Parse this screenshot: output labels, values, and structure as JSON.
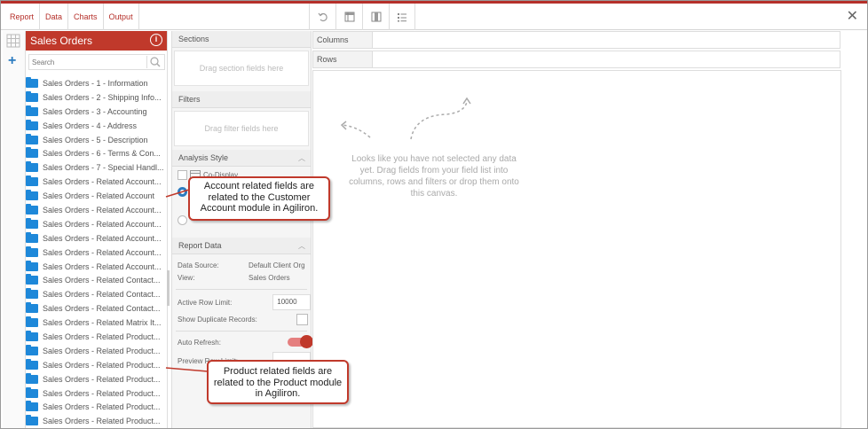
{
  "menu": {
    "tabs": [
      "Report",
      "Data",
      "Charts",
      "Output"
    ],
    "close_icon": "close-icon",
    "accent": "#b5302a"
  },
  "toolbar": {
    "icons": [
      "undo-icon",
      "pivot-table-icon",
      "column-layout-icon",
      "list-icon"
    ]
  },
  "rail": {
    "grid_icon": "grid-icon",
    "add_icon": "plus-icon"
  },
  "fieldlist": {
    "title": "Sales Orders",
    "info_icon": "info-icon",
    "search_placeholder": "Search",
    "header_color": "#c0392b",
    "folder_color": "#1e88d9",
    "items": [
      "Sales Orders - 1 - Information",
      "Sales Orders - 2 - Shipping Info...",
      "Sales Orders - 3 - Accounting",
      "Sales Orders - 4 - Address",
      "Sales Orders - 5 - Description",
      "Sales Orders - 6 - Terms & Con...",
      "Sales Orders - 7 - Special Handl...",
      "Sales Orders - Related Account...",
      "Sales Orders - Related Account",
      "Sales Orders - Related Account...",
      "Sales Orders - Related Account...",
      "Sales Orders - Related Account...",
      "Sales Orders - Related Account...",
      "Sales Orders - Related Account...",
      "Sales Orders - Related Contact...",
      "Sales Orders - Related Contact...",
      "Sales Orders - Related Contact...",
      "Sales Orders - Related Matrix It...",
      "Sales Orders - Related Product...",
      "Sales Orders - Related Product...",
      "Sales Orders - Related Product...",
      "Sales Orders - Related Product...",
      "Sales Orders - Related Product...",
      "Sales Orders - Related Product...",
      "Sales Orders - Related Product..."
    ]
  },
  "sections": {
    "title": "Sections",
    "drop_hint": "Drag section fields here"
  },
  "filters": {
    "title": "Filters",
    "drop_hint": "Drag filter fields here"
  },
  "analysis": {
    "title": "Analysis Style",
    "co_display": "Co-Display"
  },
  "report_data": {
    "title": "Report Data",
    "data_source_label": "Data Source:",
    "data_source_value": "Default Client Org",
    "view_label": "View:",
    "view_value": "Sales Orders",
    "row_limit_label": "Active Row Limit:",
    "row_limit_value": "10000",
    "dup_label": "Show Duplicate Records:",
    "auto_refresh_label": "Auto Refresh:",
    "preview_label": "Preview Row Limit:"
  },
  "canvas": {
    "columns_label": "Columns",
    "rows_label": "Rows",
    "empty_message": "Looks like you have not selected any data yet. Drag fields from your field list into columns, rows and filters or drop them onto this canvas."
  },
  "callouts": {
    "account": "Account related fields are related to the Customer Account module in Agiliron.",
    "product": "Product related fields are related to the Product module in Agiliron."
  }
}
